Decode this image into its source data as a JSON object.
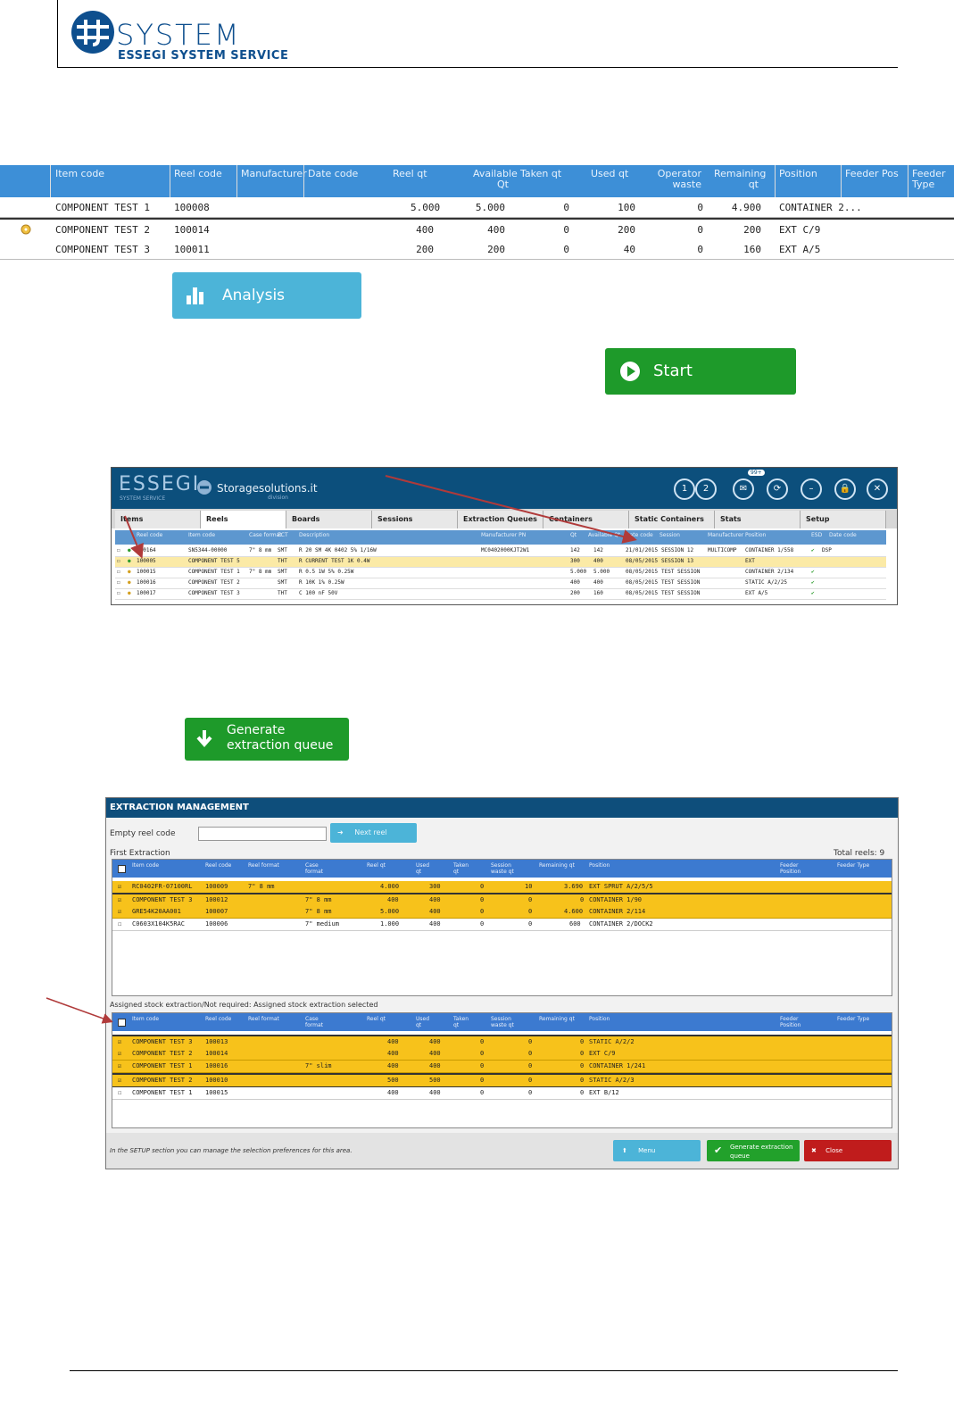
{
  "header": {
    "logo_main": "SYSTEM",
    "logo_sub": "ESSEGI SYSTEM SERVICE"
  },
  "top_table": {
    "headers": [
      "Item code",
      "Reel code",
      "Manufacturer",
      "Date code",
      "Reel qt",
      "Available Qt",
      "Taken qt",
      "Used qt",
      "Operator waste",
      "Remaining qt",
      "Position",
      "Feeder Pos",
      "Feeder Type"
    ],
    "rows": [
      [
        "COMPONENT TEST 1",
        "100008",
        "",
        "",
        "5.000",
        "5.000",
        "0",
        "100",
        "0",
        "4.900",
        "CONTAINER 2..."
      ],
      [
        "COMPONENT TEST 2",
        "100014",
        "",
        "",
        "400",
        "400",
        "0",
        "200",
        "0",
        "200",
        "EXT C/9"
      ],
      [
        "COMPONENT TEST 3",
        "100011",
        "",
        "",
        "200",
        "200",
        "0",
        "40",
        "0",
        "160",
        "EXT A/5"
      ]
    ]
  },
  "buttons": {
    "analysis": "Analysis",
    "start": "Start",
    "generate_line1": "Generate",
    "generate_line2": "extraction queue"
  },
  "app": {
    "brand": "ESSEGI",
    "brand_sub": "SYSTEM SERVICE",
    "storage": "Storagesolutions.it",
    "storage_sub": "division",
    "circle_1": "1",
    "circle_2": "2",
    "badge": "99+",
    "tabs": [
      "Items",
      "Reels",
      "Boards",
      "Sessions",
      "Extraction Queues",
      "Containers",
      "Static Containers",
      "Stats",
      "Setup"
    ],
    "grid_headers": [
      "Reel code",
      "Item code",
      "Case format",
      "ECT",
      "Description",
      "Manufacturer PN",
      "Qt",
      "Available Qt",
      "Date code",
      "Session",
      "Manufacturer",
      "Position",
      "ESD",
      "Date code"
    ],
    "grid_rows": [
      [
        "100164",
        "SN5344-00000",
        "7\" 8 mm",
        "SMT",
        "R 20 SM 4K 0402 5% 1/16W",
        "MC0402000KJT2W1",
        "142",
        "142",
        "21/01/2015",
        "SESSION 12",
        "MULTICOMP",
        "CONTAINER 1/558",
        "DSP"
      ],
      [
        "100005",
        "COMPONENT TEST 5",
        "",
        "THT",
        "R CURRENT TEST 1K 0.4W",
        "",
        "300",
        "400",
        "08/05/2015",
        "SESSION 13",
        "",
        "EXT",
        ""
      ],
      [
        "100015",
        "COMPONENT TEST 1",
        "7\" 8 mm",
        "SMT",
        "R 0.5 1W 5% 0.25W",
        "",
        "5.000",
        "5.000",
        "08/05/2015",
        "TEST SESSION",
        "",
        "CONTAINER 2/134",
        ""
      ],
      [
        "100016",
        "COMPONENT TEST 2",
        "",
        "SMT",
        "R 10K 1% 0.25W",
        "",
        "400",
        "400",
        "08/05/2015",
        "TEST SESSION",
        "",
        "STATIC A/2/25",
        ""
      ],
      [
        "100017",
        "COMPONENT TEST 3",
        "",
        "THT",
        "C 100 nF 50V",
        "",
        "200",
        "160",
        "08/05/2015",
        "TEST SESSION",
        "",
        "EXT A/5",
        ""
      ]
    ]
  },
  "extraction": {
    "title": "EXTRACTION MANAGEMENT",
    "empty_reel_label": "Empty reel code",
    "next_reel": "Next reel",
    "first_extraction": "First Extraction",
    "total_reels": "Total reels: 9",
    "headers": [
      "Item code",
      "Reel code",
      "Reel format",
      "Case format",
      "Reel qt",
      "Used qt",
      "Taken qt",
      "Session waste qt",
      "Remaining qt",
      "Position",
      "Feeder Position",
      "Feeder Type"
    ],
    "first_rows": [
      [
        "RC0402FR-07100RL",
        "100009",
        "7\" 8 mm",
        "",
        "4.000",
        "300",
        "0",
        "10",
        "3.690",
        "EXT SPRUT A/2/5/5"
      ],
      [
        "COMPONENT TEST 3",
        "100012",
        "",
        "7\" 8 mm",
        "400",
        "400",
        "0",
        "0",
        "0",
        "CONTAINER 1/90"
      ],
      [
        "GRE54K20AA001",
        "100007",
        "",
        "7\" 8 mm",
        "5.000",
        "400",
        "0",
        "0",
        "4.600",
        "CONTAINER 2/114"
      ],
      [
        "C0603X104K5RAC",
        "100006",
        "",
        "7\" medium",
        "1.000",
        "400",
        "0",
        "0",
        "600",
        "CONTAINER 2/DOCK2"
      ]
    ],
    "assigned_label": "Assigned stock extraction/Not required: Assigned stock extraction selected",
    "second_rows": [
      [
        "COMPONENT TEST 3",
        "100013",
        "",
        "",
        "400",
        "400",
        "0",
        "0",
        "0",
        "STATIC A/2/2"
      ],
      [
        "COMPONENT TEST 2",
        "100014",
        "",
        "",
        "400",
        "400",
        "0",
        "0",
        "0",
        "EXT C/9"
      ],
      [
        "COMPONENT TEST 1",
        "100016",
        "",
        "7\" slim",
        "400",
        "400",
        "0",
        "0",
        "0",
        "CONTAINER 1/241"
      ],
      [
        "COMPONENT TEST 2",
        "100010",
        "",
        "",
        "500",
        "500",
        "0",
        "0",
        "0",
        "STATIC A/2/3"
      ],
      [
        "COMPONENT TEST 1",
        "100015",
        "",
        "",
        "400",
        "400",
        "0",
        "0",
        "0",
        "EXT B/12"
      ]
    ],
    "footer_note": "In the SETUP section you can manage the selection preferences for this area.",
    "menu": "Menu",
    "generate": "Generate extraction queue",
    "close": "Close"
  },
  "colors": {
    "brand_blue": "#0e4f8e",
    "header_blue": "#3d8fd7",
    "green": "#1e9a2a",
    "cyan": "#4cb4d8",
    "yellow": "#f7c21b",
    "red": "#c01c1c",
    "arrow": "#b03a3a"
  }
}
